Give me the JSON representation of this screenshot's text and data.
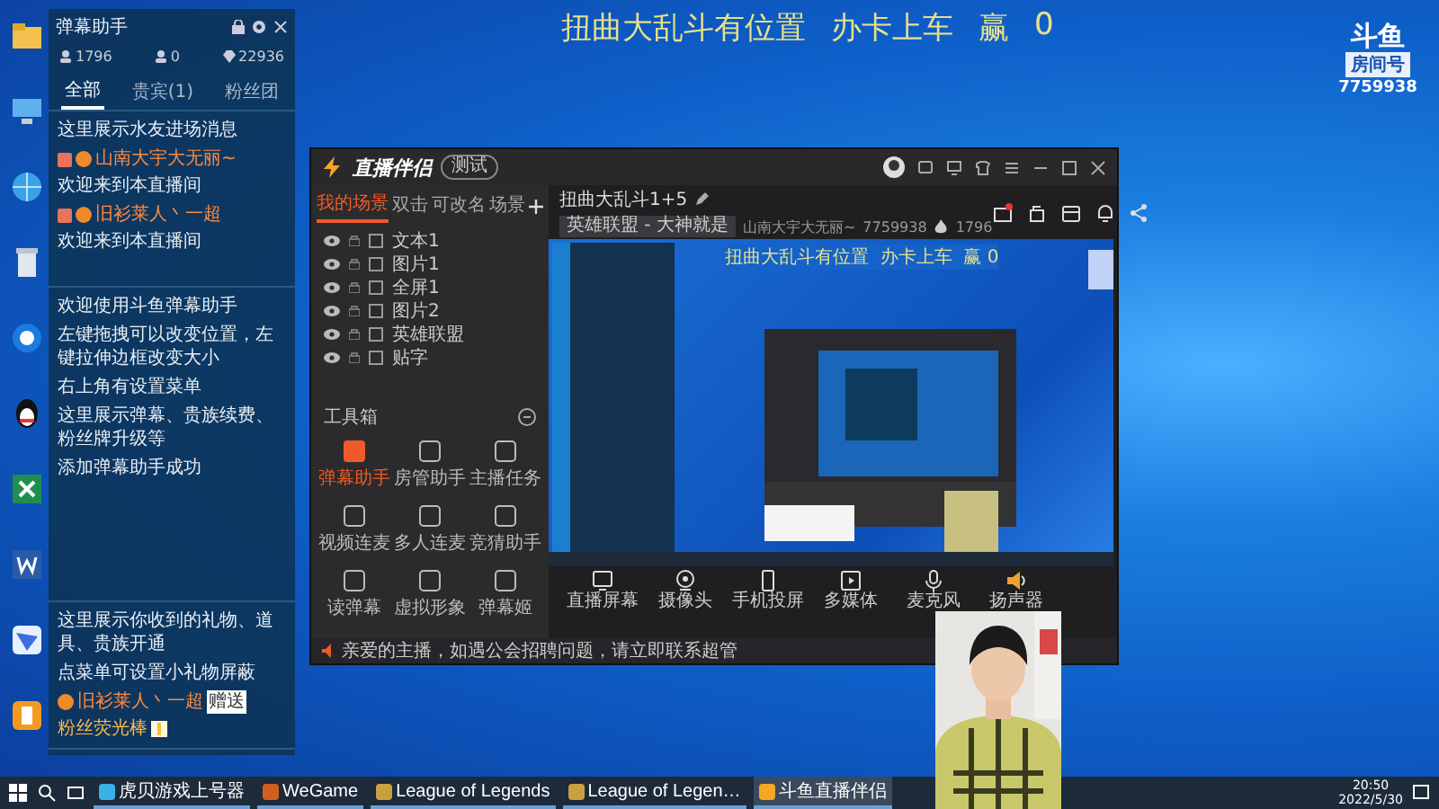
{
  "desktop_overlay": {
    "title": "扭曲大乱斗有位置",
    "subtitle": "办卡上车",
    "score_label": "赢",
    "score": "0"
  },
  "room_badge": {
    "logo": "斗鱼",
    "label": "房间号",
    "number": "7759938"
  },
  "danmu_panel": {
    "title": "弹幕助手",
    "stats": [
      "1796",
      "0",
      "22936"
    ],
    "tabs": [
      {
        "label": "全部",
        "selected": true
      },
      {
        "label": "贵宾(1)",
        "selected": false
      },
      {
        "label": "粉丝团",
        "selected": false
      }
    ],
    "sections": [
      {
        "items": [
          {
            "kind": "notice",
            "text": "这里展示水友进场消息"
          },
          {
            "kind": "entry",
            "user": "山南大宇大无丽~",
            "text": "欢迎来到本直播间"
          },
          {
            "kind": "entry",
            "user": "旧衫莱人丶一超",
            "text": "欢迎来到本直播间"
          }
        ]
      },
      {
        "items": [
          {
            "kind": "notice",
            "text": "欢迎使用斗鱼弹幕助手"
          },
          {
            "kind": "notice",
            "text": "左键拖拽可以改变位置，左键拉伸边框改变大小"
          },
          {
            "kind": "notice",
            "text": "右上角有设置菜单"
          },
          {
            "kind": "notice",
            "text": "这里展示弹幕、贵族续费、粉丝牌升级等"
          },
          {
            "kind": "notice",
            "text": "添加弹幕助手成功"
          }
        ]
      },
      {
        "items": [
          {
            "kind": "notice",
            "text": "这里展示你收到的礼物、道具、贵族开通"
          },
          {
            "kind": "notice",
            "text": "点菜单可设置小礼物屏蔽"
          },
          {
            "kind": "gift",
            "user": "旧衫莱人丶一超",
            "action": "赠送",
            "text": "粉丝荧光棒"
          }
        ]
      }
    ]
  },
  "app": {
    "logo": "直播伴侣",
    "mode": "测试",
    "scene_tabs": [
      {
        "label": "我的场景",
        "selected": true
      },
      {
        "label": "双击",
        "selected": false
      },
      {
        "label": "可改名",
        "selected": false
      },
      {
        "label": "场景",
        "selected": false
      }
    ],
    "sources": [
      "文本1",
      "图片1",
      "全屏1",
      "图片2",
      "英雄联盟",
      "贴字"
    ],
    "toolbox": {
      "title": "工具箱",
      "tools": [
        {
          "label": "弹幕助手",
          "selected": true
        },
        {
          "label": "房管助手",
          "selected": false
        },
        {
          "label": "主播任务",
          "selected": false
        },
        {
          "label": "视频连麦",
          "selected": false
        },
        {
          "label": "多人连麦",
          "selected": false
        },
        {
          "label": "竞猜助手",
          "selected": false
        },
        {
          "label": "读弹幕",
          "selected": false
        },
        {
          "label": "虚拟形象",
          "selected": false
        },
        {
          "label": "弹幕姬",
          "selected": false
        }
      ]
    },
    "notice": "亲爱的主播，如遇公会招聘问题，请立即联系超管",
    "room": {
      "title": "扭曲大乱斗1+5",
      "tag": "英雄联盟 - 大神就是",
      "streamer": "山南大宇大无丽~",
      "room_id": "7759938",
      "followers": "1796"
    },
    "preview": {
      "title": "扭曲大乱斗有位置  办卡上车  赢 0"
    },
    "controls": [
      "直播屏幕",
      "摄像头",
      "手机投屏",
      "多媒体",
      "麦克风",
      "扬声器"
    ]
  },
  "taskbar": {
    "items": [
      {
        "label": "虎贝游戏上号器",
        "selected": false
      },
      {
        "label": "WeGame",
        "selected": false
      },
      {
        "label": "League of Legends",
        "selected": false
      },
      {
        "label": "League of Legen…",
        "selected": false
      },
      {
        "label": "斗鱼直播伴侣",
        "selected": true
      }
    ],
    "time": "20:50",
    "date": "2022/5/30"
  }
}
